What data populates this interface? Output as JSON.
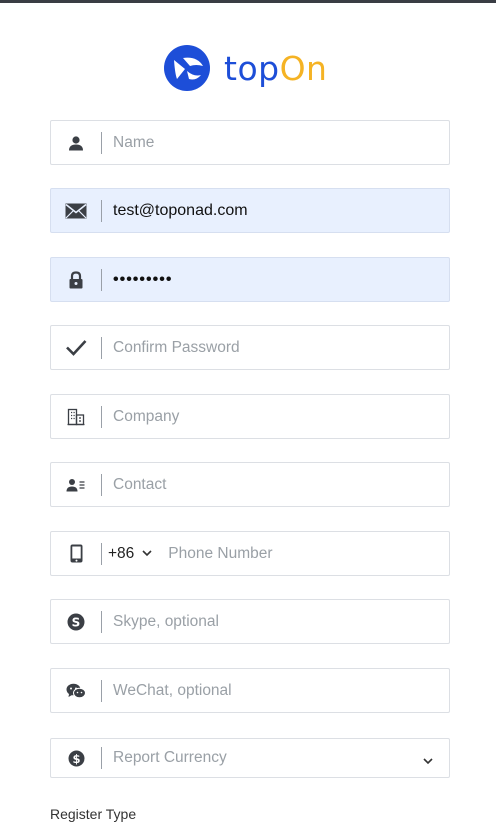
{
  "logo": {
    "text_part1": "top",
    "text_part2": "On",
    "icon": "topon-logo-icon",
    "brand_blue": "#1d4ed8",
    "brand_yellow": "#f5b324"
  },
  "form": {
    "name": {
      "placeholder": "Name",
      "icon": "user-icon"
    },
    "email": {
      "value": "test@toponad.com",
      "icon": "envelope-icon"
    },
    "password": {
      "value": "•••••••••",
      "icon": "lock-icon"
    },
    "confirm_password": {
      "placeholder": "Confirm Password",
      "icon": "check-icon"
    },
    "company": {
      "placeholder": "Company",
      "icon": "building-icon"
    },
    "contact": {
      "placeholder": "Contact",
      "icon": "contact-card-icon"
    },
    "phone": {
      "country_code": "+86",
      "placeholder": "Phone Number",
      "icon": "mobile-phone-icon"
    },
    "skype": {
      "placeholder": "Skype, optional",
      "icon": "skype-icon"
    },
    "wechat": {
      "placeholder": "WeChat, optional",
      "icon": "wechat-icon"
    },
    "currency": {
      "placeholder": "Report Currency",
      "icon": "dollar-circle-icon"
    }
  },
  "bottom_label": "Register Type"
}
